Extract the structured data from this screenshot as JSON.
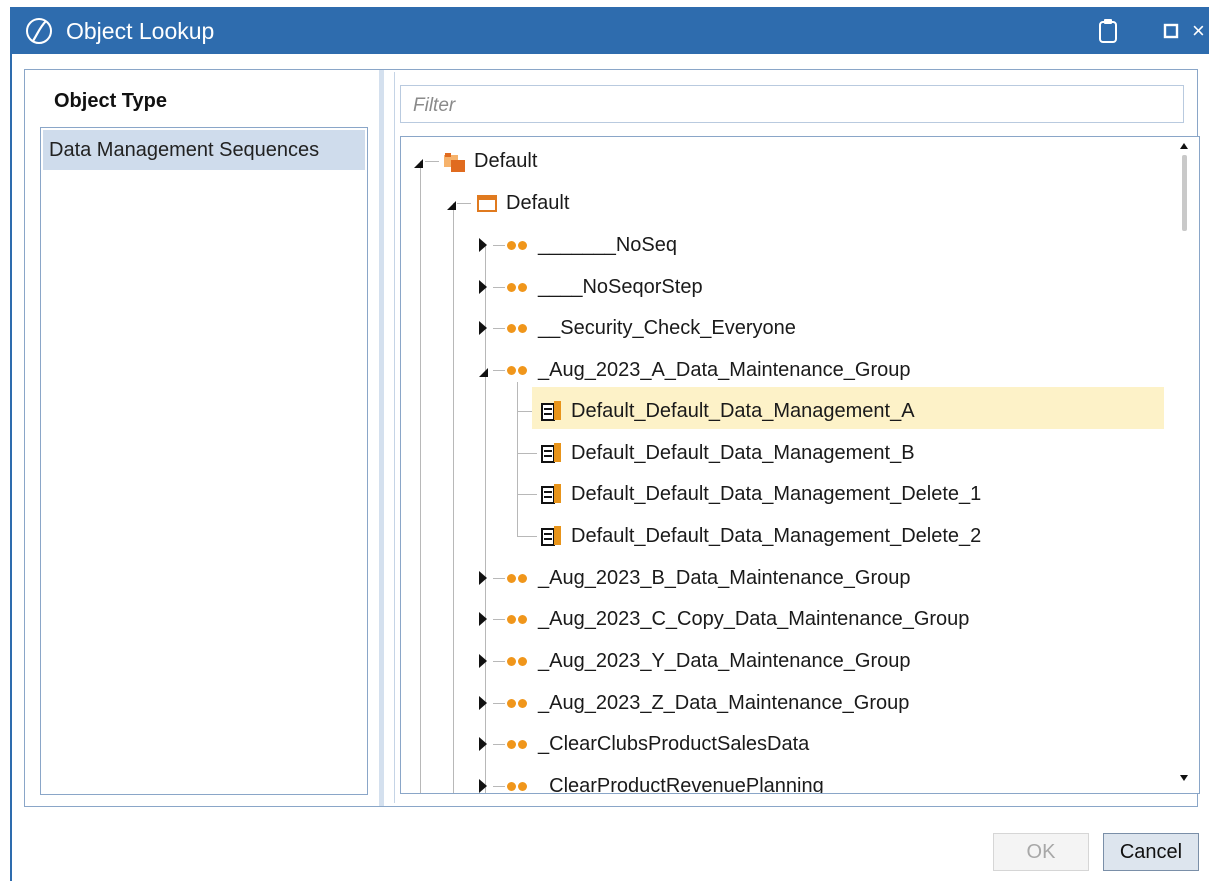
{
  "window": {
    "title": "Object Lookup",
    "icons": [
      "app-logo-icon",
      "clipboard-icon",
      "maximize-icon",
      "close-icon"
    ],
    "close_glyph": "×"
  },
  "left_panel": {
    "heading": "Object Type",
    "items": [
      "Data Management Sequences"
    ],
    "selected": "Data Management Sequences"
  },
  "filter": {
    "placeholder": "Filter",
    "value": ""
  },
  "tree": {
    "root": "Default",
    "workflow": "Default",
    "groups": [
      "_______NoSeq",
      "____NoSeqorStep",
      "__Security_Check_Everyone",
      "_Aug_2023_A_Data_Maintenance_Group",
      "_Aug_2023_B_Data_Maintenance_Group",
      "_Aug_2023_C_Copy_Data_Maintenance_Group",
      "_Aug_2023_Y_Data_Maintenance_Group",
      "_Aug_2023_Z_Data_Maintenance_Group",
      "_ClearClubsProductSalesData",
      "_ClearProductRevenuePlanning"
    ],
    "expanded_group": "_Aug_2023_A_Data_Maintenance_Group",
    "sequences": [
      "Default_Default_Data_Management_A",
      "Default_Default_Data_Management_B",
      "Default_Default_Data_Management_Delete_1",
      "Default_Default_Data_Management_Delete_2"
    ],
    "selected": "Default_Default_Data_Management_A"
  },
  "colors": {
    "titlebar": "#2e6cae",
    "selection": "#fdf2c8",
    "group_dot": "#f0961b",
    "list_selection": "#cfdcec"
  },
  "buttons": {
    "ok": "OK",
    "cancel": "Cancel",
    "ok_enabled": false
  }
}
